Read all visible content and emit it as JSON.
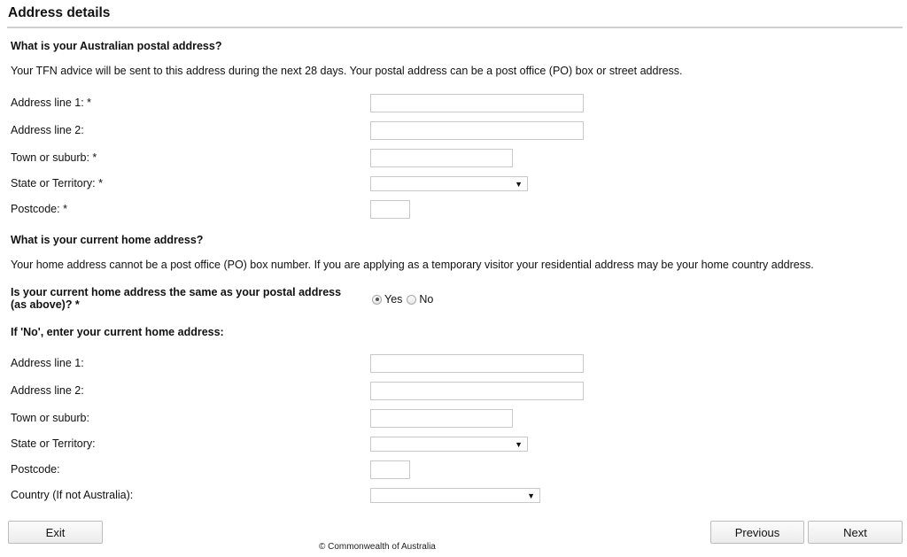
{
  "page": {
    "title": "Address details"
  },
  "postal": {
    "heading": "What is your Australian postal address?",
    "description": "Your TFN advice will be sent to this address during the next 28 days. Your postal address can be a post office (PO) box or street address.",
    "fields": {
      "address_line_1": {
        "label": "Address line 1: *",
        "value": ""
      },
      "address_line_2": {
        "label": "Address line 2:",
        "value": ""
      },
      "town": {
        "label": "Town or suburb: *",
        "value": ""
      },
      "state": {
        "label": "State or Territory: *",
        "selected": ""
      },
      "postcode": {
        "label": "Postcode: *",
        "value": ""
      }
    }
  },
  "home": {
    "heading": "What is your current home address?",
    "description": "Your home address cannot be a post office (PO) box number. If you are applying as a temporary visitor your residential address may be your home country address.",
    "same_question_line1": "Is your current home address the same as your postal address",
    "same_question_line2": "(as above)? *",
    "options": {
      "yes": "Yes",
      "no": "No",
      "selected": "Yes"
    },
    "if_no_heading": "If 'No', enter your current home address:",
    "fields": {
      "address_line_1": {
        "label": "Address line 1:",
        "value": ""
      },
      "address_line_2": {
        "label": "Address line 2:",
        "value": ""
      },
      "town": {
        "label": "Town or suburb:",
        "value": ""
      },
      "state": {
        "label": "State or Territory:",
        "selected": ""
      },
      "postcode": {
        "label": "Postcode:",
        "value": ""
      },
      "country": {
        "label": "Country (If not Australia):",
        "selected": ""
      }
    }
  },
  "icons": {
    "dropdown_arrow": "▼"
  },
  "buttons": {
    "exit": "Exit",
    "previous": "Previous",
    "next": "Next"
  },
  "footer": {
    "copyright": "© Commonwealth of Australia"
  }
}
